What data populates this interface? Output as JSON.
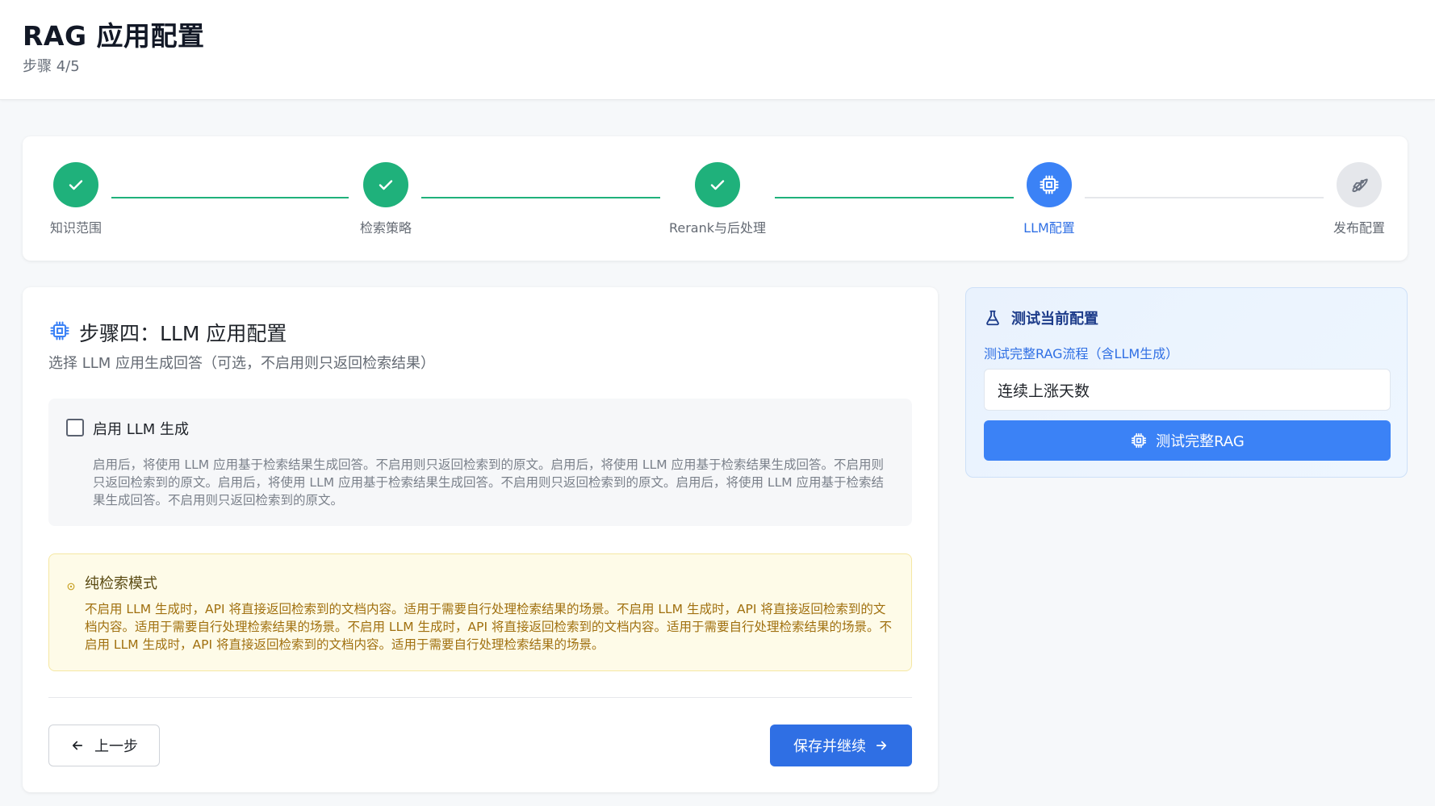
{
  "header": {
    "title": "RAG 应用配置",
    "subtitle": "步骤 4/5"
  },
  "stepper": {
    "steps": [
      {
        "label": "知识范围",
        "status": "done"
      },
      {
        "label": "检索策略",
        "status": "done"
      },
      {
        "label": "Rerank与后处理",
        "status": "done"
      },
      {
        "label": "LLM配置",
        "status": "active"
      },
      {
        "label": "发布配置",
        "status": "pending"
      }
    ]
  },
  "main": {
    "title": "步骤四：LLM 应用配置",
    "description": "选择 LLM 应用生成回答（可选，不启用则只返回检索结果）",
    "llm_toggle": {
      "label": "启用 LLM 生成",
      "checked": false,
      "description": "启用后，将使用 LLM 应用基于检索结果生成回答。不启用则只返回检索到的原文。启用后，将使用 LLM 应用基于检索结果生成回答。不启用则只返回检索到的原文。启用后，将使用 LLM 应用基于检索结果生成回答。不启用则只返回检索到的原文。启用后，将使用 LLM 应用基于检索结果生成回答。不启用则只返回检索到的原文。"
    },
    "notice": {
      "title": "纯检索模式",
      "description": "不启用 LLM 生成时，API 将直接返回检索到的文档内容。适用于需要自行处理检索结果的场景。不启用 LLM 生成时，API 将直接返回检索到的文档内容。适用于需要自行处理检索结果的场景。不启用 LLM 生成时，API 将直接返回检索到的文档内容。适用于需要自行处理检索结果的场景。不启用 LLM 生成时，API 将直接返回检索到的文档内容。适用于需要自行处理检索结果的场景。"
    },
    "prev_label": "上一步",
    "next_label": "保存并继续"
  },
  "test_panel": {
    "title": "测试当前配置",
    "subtitle": "测试完整RAG流程（含LLM生成）",
    "input_value": "连续上涨天数",
    "button_label": "测试完整RAG"
  },
  "colors": {
    "done": "#1fb17b",
    "active": "#3b82f6",
    "pending": "#e5e7eb",
    "primary_button": "#2f6fe4",
    "notice_bg": "#fefbe8"
  },
  "icons": {
    "done": "check-icon",
    "active": "chip-icon",
    "pending": "rocket-icon"
  }
}
